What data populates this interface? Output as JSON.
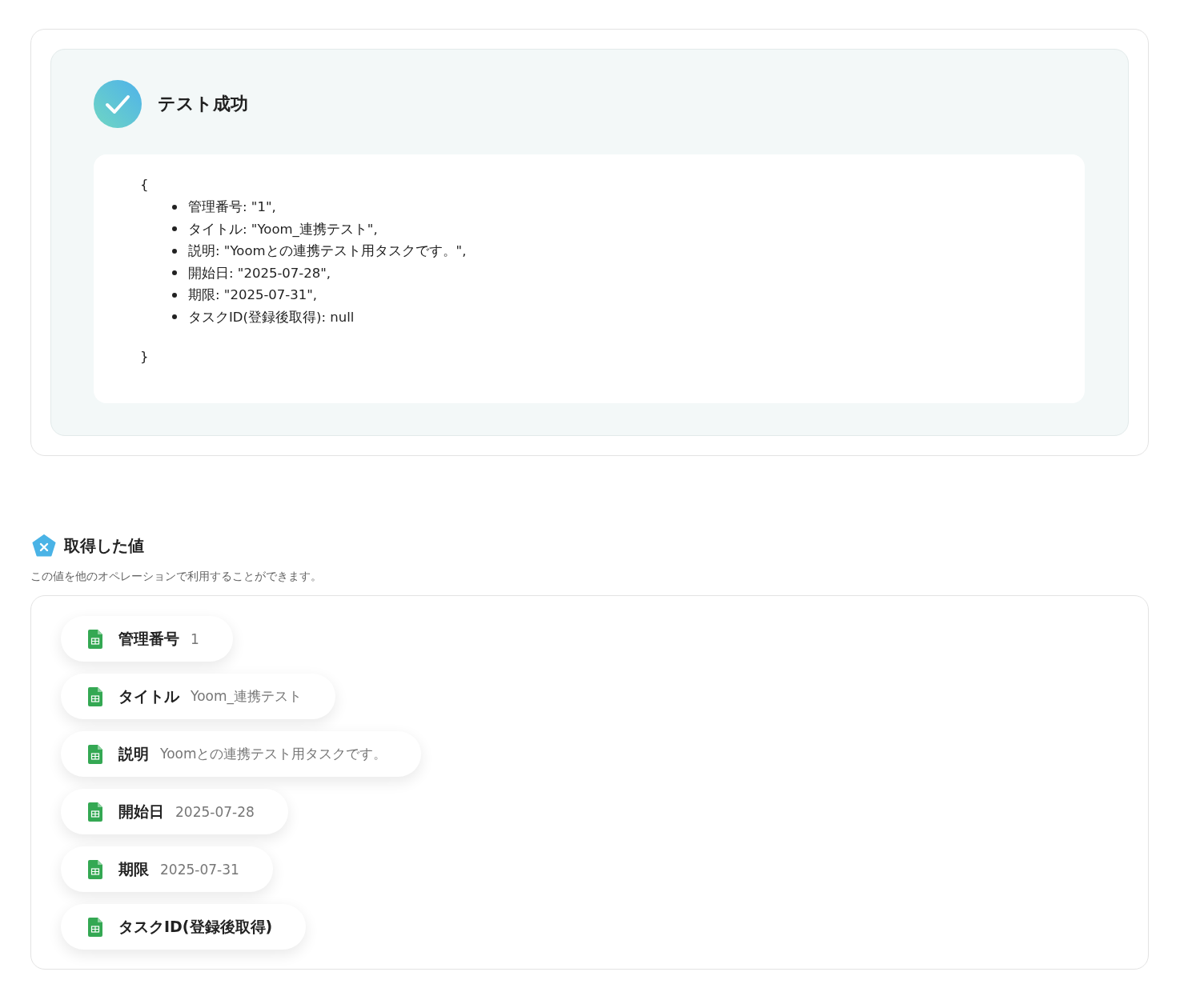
{
  "test_result": {
    "succeeded": true,
    "title": "テスト成功",
    "open_brace": "{",
    "close_brace": "}",
    "lines": [
      "管理番号: \"1\",",
      "タイトル: \"Yoom_連携テスト\",",
      "説明: \"Yoomとの連携テスト用タスクです。\",",
      "開始日: \"2025-07-28\",",
      "期限: \"2025-07-31\",",
      "タスクID(登録後取得): null"
    ]
  },
  "values_section": {
    "title": "取得した値",
    "description": "この値を他のオペレーションで利用することができます。",
    "items": [
      {
        "label": "管理番号",
        "value": "1"
      },
      {
        "label": "タイトル",
        "value": "Yoom_連携テスト"
      },
      {
        "label": "説明",
        "value": "Yoomとの連携テスト用タスクです。"
      },
      {
        "label": "開始日",
        "value": "2025-07-28"
      },
      {
        "label": "期限",
        "value": "2025-07-31"
      },
      {
        "label": "タスクID(登録後取得)"
      }
    ]
  }
}
